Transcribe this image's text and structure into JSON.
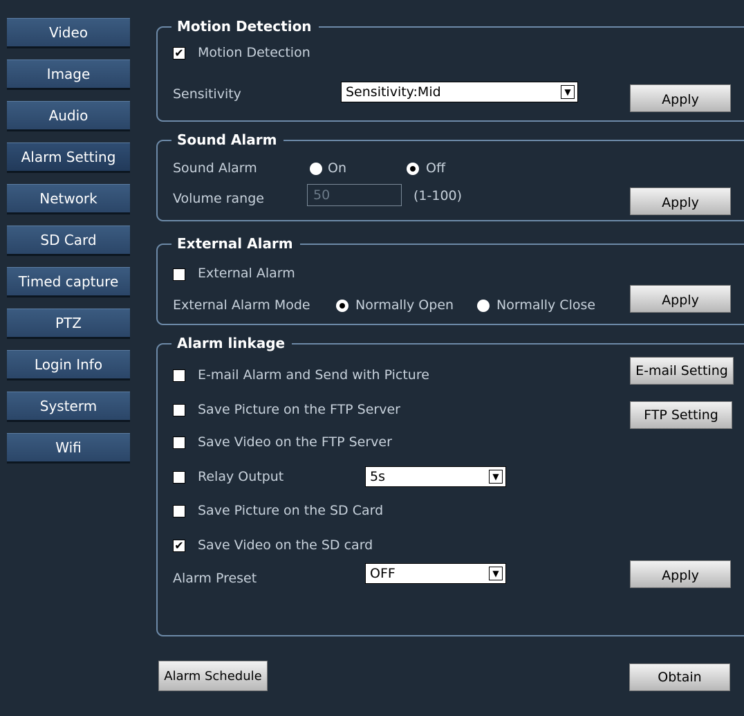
{
  "sidebar": {
    "items": [
      {
        "label": "Video"
      },
      {
        "label": "Image"
      },
      {
        "label": "Audio"
      },
      {
        "label": "Alarm Setting"
      },
      {
        "label": "Network"
      },
      {
        "label": "SD Card"
      },
      {
        "label": "Timed capture"
      },
      {
        "label": "PTZ"
      },
      {
        "label": "Login Info"
      },
      {
        "label": "Systerm"
      },
      {
        "label": "Wifi"
      }
    ],
    "active": "Alarm Setting"
  },
  "motion": {
    "title": "Motion Detection",
    "checkbox_label": "Motion Detection",
    "checkbox_checked": true,
    "sensitivity_label": "Sensitivity",
    "sensitivity_value": "Sensitivity:Mid",
    "apply": "Apply"
  },
  "sound": {
    "title": "Sound Alarm",
    "label": "Sound Alarm",
    "on_label": "On",
    "off_label": "Off",
    "selected": "Off",
    "volume_label": "Volume range",
    "volume_value": "50",
    "volume_range": "(1-100)",
    "apply": "Apply"
  },
  "external": {
    "title": "External Alarm",
    "checkbox_label": "External Alarm",
    "checkbox_checked": false,
    "mode_label": "External Alarm Mode",
    "open_label": "Normally Open",
    "close_label": "Normally Close",
    "selected": "Normally Open",
    "apply": "Apply"
  },
  "linkage": {
    "title": "Alarm linkage",
    "email_label": "E-mail Alarm and Send with Picture",
    "email_button": "E-mail Setting",
    "ftp_pic_label": "Save Picture on the FTP Server",
    "ftp_button": "FTP Setting",
    "ftp_video_label": "Save Video on the FTP Server",
    "relay_label": "Relay Output",
    "relay_value": "5s",
    "sd_pic_label": "Save Picture on the SD Card",
    "sd_video_label": "Save Video on the SD card",
    "sd_video_checked": true,
    "preset_label": "Alarm Preset",
    "preset_value": "OFF",
    "apply": "Apply"
  },
  "footer": {
    "schedule_button": "Alarm Schedule",
    "obtain_button": "Obtain"
  },
  "colors": {
    "background": "#1f2b38",
    "nav_button": "#345276",
    "group_border": "#6d8aa8"
  }
}
